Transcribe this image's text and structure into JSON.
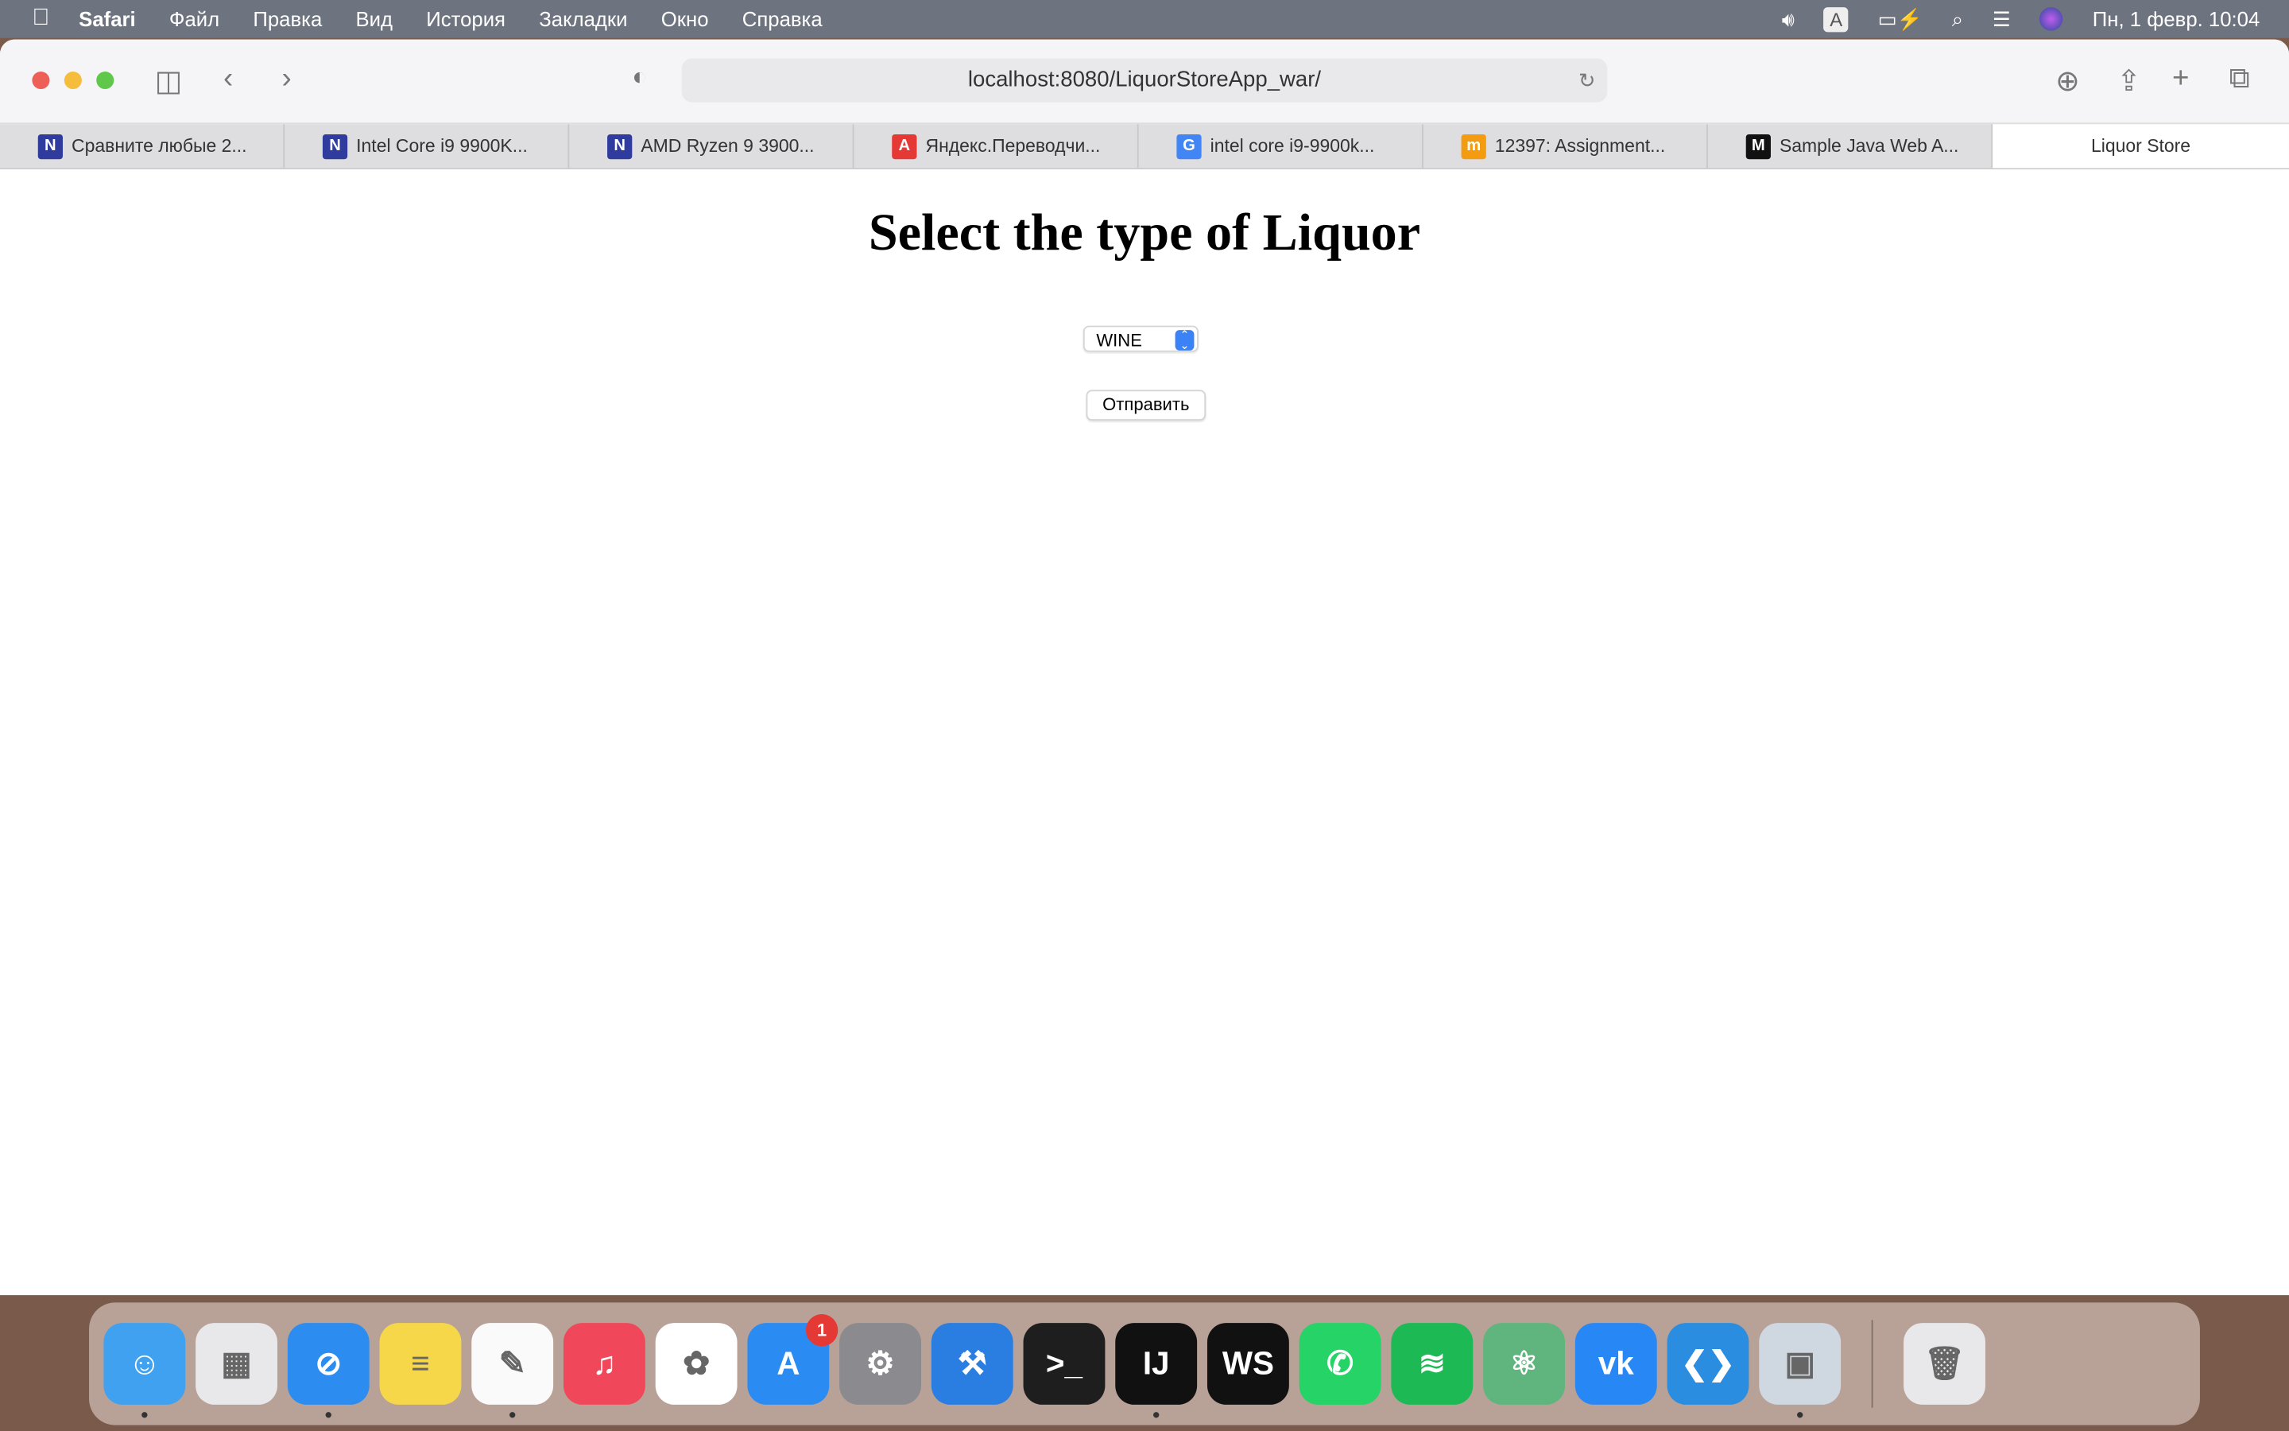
{
  "menubar": {
    "app": "Safari",
    "items": [
      "Файл",
      "Правка",
      "Вид",
      "История",
      "Закладки",
      "Окно",
      "Справка"
    ],
    "input_source": "A",
    "datetime": "Пн, 1 февр.  10:04"
  },
  "browser": {
    "url": "localhost:8080/LiquorStoreApp_war/",
    "tabs": [
      {
        "label": "Сравните любые 2...",
        "icon": "N",
        "color": "#2f3c9e"
      },
      {
        "label": "Intel Core i9 9900K...",
        "icon": "N",
        "color": "#2f3c9e"
      },
      {
        "label": "AMD Ryzen 9 3900...",
        "icon": "N",
        "color": "#2f3c9e"
      },
      {
        "label": "Яндекс.Переводчи...",
        "icon": "A",
        "color": "#e53935"
      },
      {
        "label": "intel core i9-9900k...",
        "icon": "G",
        "color": "#4285f4"
      },
      {
        "label": "12397: Assignment...",
        "icon": "m",
        "color": "#f39c12"
      },
      {
        "label": "Sample Java Web A...",
        "icon": "M",
        "color": "#111111"
      },
      {
        "label": "Liquor Store",
        "active": true
      }
    ]
  },
  "page": {
    "title": "Select the type of Liquor",
    "select_value": "WINE",
    "submit_label": "Отправить"
  },
  "dock": [
    {
      "name": "finder",
      "label": "☺",
      "bg": "#3fa1f0",
      "running": true
    },
    {
      "name": "launchpad",
      "label": "▦",
      "bg": "#e8e8ea"
    },
    {
      "name": "safari",
      "label": "⊘",
      "bg": "#2d8cf0",
      "running": true
    },
    {
      "name": "notes",
      "label": "≡",
      "bg": "#f7d74a"
    },
    {
      "name": "pages",
      "label": "✎",
      "bg": "#fafafa",
      "running": true
    },
    {
      "name": "music",
      "label": "♫",
      "bg": "#f0485a"
    },
    {
      "name": "photos",
      "label": "✿",
      "bg": "#ffffff"
    },
    {
      "name": "app-store",
      "label": "A",
      "bg": "#2a8cf3",
      "badge": "1"
    },
    {
      "name": "system-preferences",
      "label": "⚙",
      "bg": "#8a8a8f"
    },
    {
      "name": "xcode",
      "label": "⚒",
      "bg": "#2a7de1"
    },
    {
      "name": "terminal",
      "label": ">_",
      "bg": "#1e1e1e"
    },
    {
      "name": "intellij-idea",
      "label": "IJ",
      "bg": "#111111",
      "running": true
    },
    {
      "name": "webstorm",
      "label": "WS",
      "bg": "#111111"
    },
    {
      "name": "whatsapp",
      "label": "✆",
      "bg": "#25d366"
    },
    {
      "name": "spotify",
      "label": "≋",
      "bg": "#1db954"
    },
    {
      "name": "atom",
      "label": "⚛",
      "bg": "#5fb57d"
    },
    {
      "name": "vk",
      "label": "vk",
      "bg": "#2787f5"
    },
    {
      "name": "vscode",
      "label": "❮❯",
      "bg": "#2a8de0"
    },
    {
      "name": "preview",
      "label": "▣",
      "bg": "#cfd8e0",
      "running": true
    },
    {
      "name": "trash",
      "label": "🗑",
      "bg": "#e8e8ea"
    }
  ]
}
